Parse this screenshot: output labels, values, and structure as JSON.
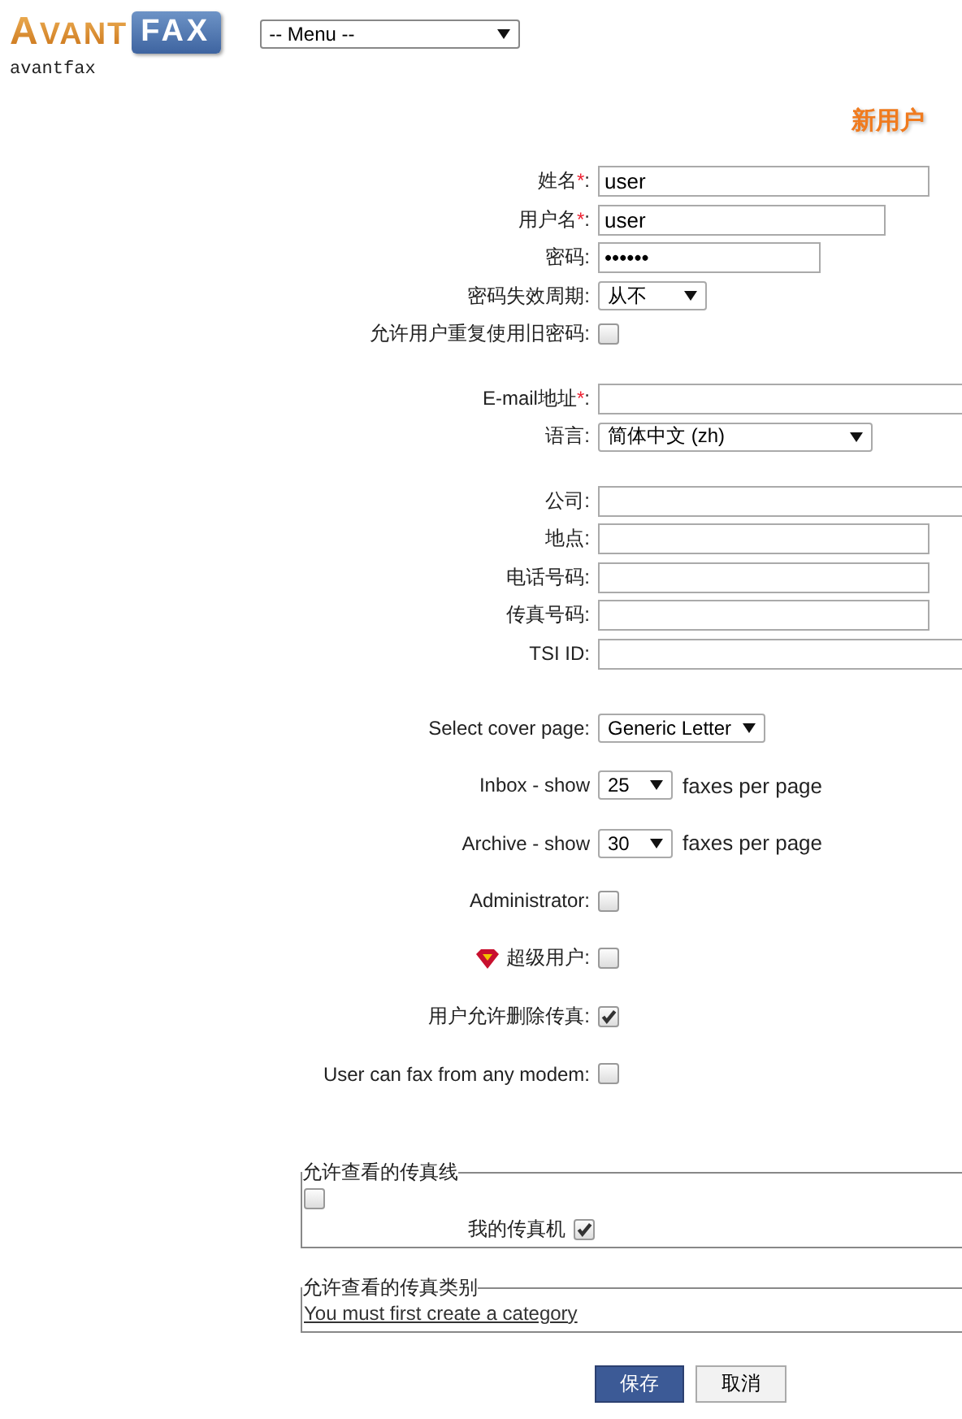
{
  "header": {
    "logo": {
      "left": "AVANT",
      "right": "FAX"
    },
    "username": "avantfax",
    "menu": {
      "value": "-- Menu --"
    }
  },
  "page_title": "新用户",
  "sections": [
    {
      "kind": "compact",
      "rows": [
        {
          "kind": "text",
          "label": "姓名",
          "required_mark": "*",
          "label_end": ":",
          "value": "user"
        },
        {
          "kind": "text",
          "label": "用户名",
          "required_mark": "*",
          "label_end": ":",
          "value": "user"
        },
        {
          "kind": "password",
          "label": "密码:",
          "value": "••••••"
        },
        {
          "kind": "select",
          "label": "密码失效周期:",
          "value": "从不"
        },
        {
          "kind": "checkbox",
          "label": "允许用户重复使用旧密码:",
          "checked": false
        }
      ]
    },
    {
      "kind": "compact",
      "rows": [
        {
          "kind": "text",
          "label": "E-mail地址",
          "required_mark": "*",
          "label_end": ":",
          "value": ""
        },
        {
          "kind": "select",
          "label": "语言:",
          "value": "简体中文 (zh)"
        }
      ]
    },
    {
      "kind": "compact",
      "rows": [
        {
          "kind": "text",
          "label": "公司:"
        },
        {
          "kind": "text",
          "label": "地点:"
        },
        {
          "kind": "text",
          "label": "电话号码:"
        },
        {
          "kind": "text",
          "label": "传真号码:"
        },
        {
          "kind": "text",
          "label": "TSI ID:"
        }
      ]
    },
    {
      "kind": "spaced",
      "rows": [
        {
          "kind": "select",
          "label": "Select cover page:",
          "value": "Generic Letter"
        },
        {
          "kind": "select",
          "label": "Inbox - show",
          "value": "25",
          "suffix": "faxes per page"
        },
        {
          "kind": "select",
          "label": "Archive - show",
          "value": "30",
          "suffix": "faxes per page"
        },
        {
          "kind": "checkbox",
          "label": "Administrator:",
          "checked": false
        },
        {
          "kind": "checkbox",
          "label": "超级用户:",
          "checked": false,
          "icon": true
        },
        {
          "kind": "checkbox",
          "label": "用户允许删除传真:",
          "checked": true
        },
        {
          "kind": "checkbox",
          "label": "User can fax from any modem:",
          "checked": false
        }
      ]
    }
  ],
  "fax_lines": {
    "legend": "允许查看的传真线",
    "all_checked": false,
    "items": [
      {
        "label": "我的传真机",
        "checked": true
      }
    ]
  },
  "fax_categories": {
    "legend": "允许查看的传真类别",
    "link": "You must first create a category"
  },
  "buttons": [
    {
      "label": "保存",
      "kind": "primary"
    },
    {
      "label": "取消",
      "kind": "secondary"
    }
  ]
}
